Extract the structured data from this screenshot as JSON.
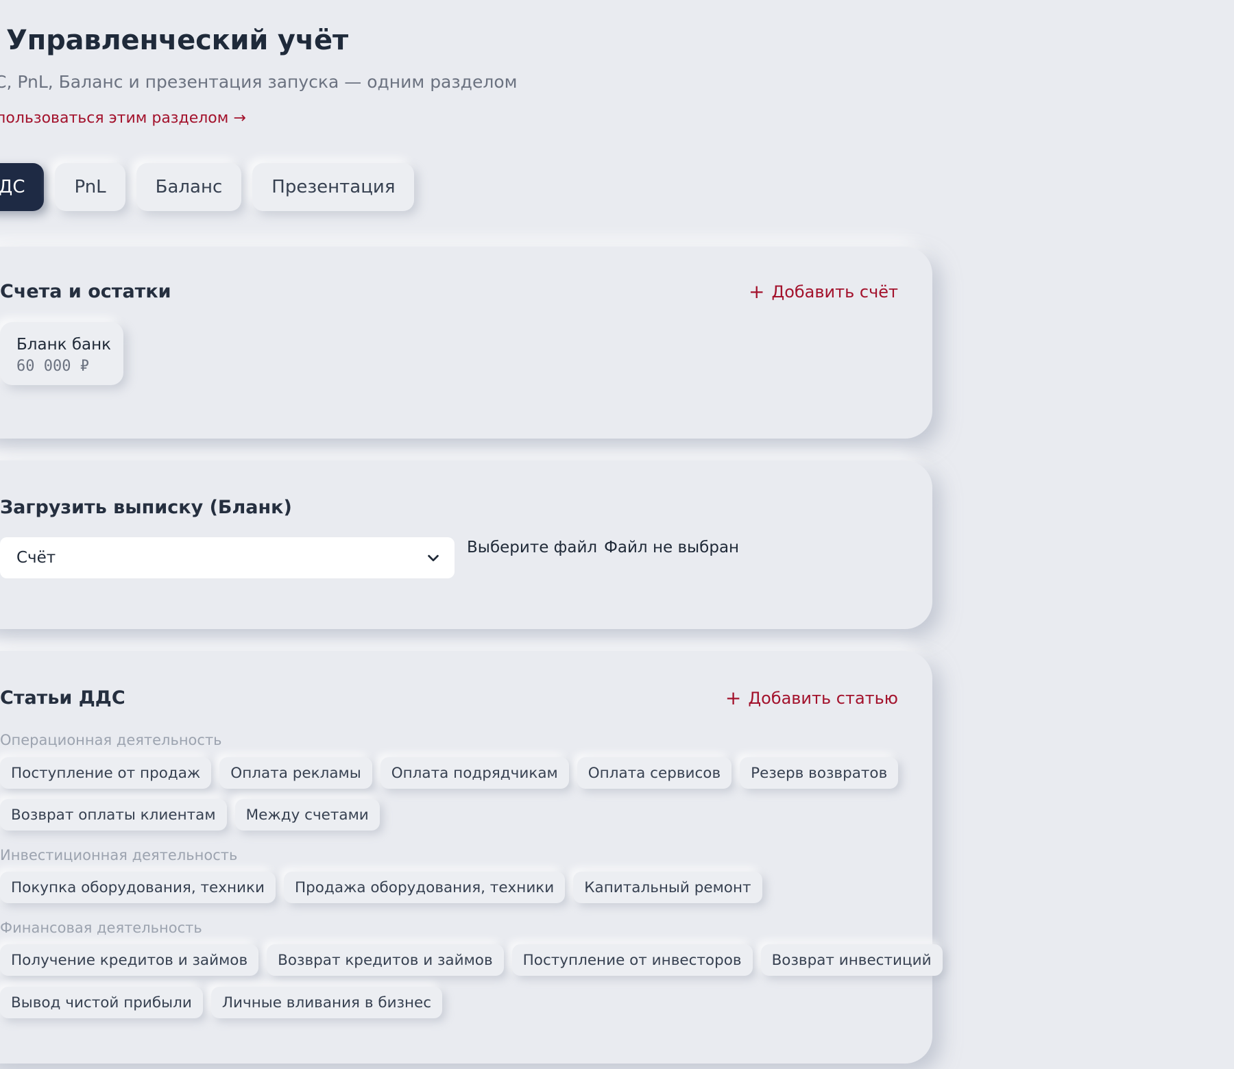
{
  "header": {
    "title": "Управленческий учёт",
    "subtitle": "С, PnL, Баланс и презентация запуска — одним разделом",
    "help_link": "пользоваться этим разделом →"
  },
  "tabs": [
    {
      "label": "ДС",
      "active": true
    },
    {
      "label": "PnL",
      "active": false
    },
    {
      "label": "Баланс",
      "active": false
    },
    {
      "label": "Презентация",
      "active": false
    }
  ],
  "accounts": {
    "title": "Счета и остатки",
    "add_label": "Добавить счёт",
    "items": [
      {
        "name": "Бланк банк",
        "balance": "60 000 ₽"
      }
    ]
  },
  "upload": {
    "title": "Загрузить выписку (Бланк)",
    "select_value": "Счёт",
    "file_button": "Выберите файл",
    "file_status": "Файл не выбран"
  },
  "categories": {
    "title": "Статьи ДДС",
    "add_label": "Добавить статью",
    "groups": [
      {
        "label": "Операционная деятельность",
        "items": [
          "Поступление от продаж",
          "Оплата рекламы",
          "Оплата подрядчикам",
          "Оплата сервисов",
          "Резерв возвратов",
          "Возврат оплаты клиентам",
          "Между счетами"
        ]
      },
      {
        "label": "Инвестиционная деятельность",
        "items": [
          "Покупка оборудования, техники",
          "Продажа оборудования, техники",
          "Капитальный ремонт"
        ]
      },
      {
        "label": "Финансовая деятельность",
        "items": [
          "Получение кредитов и займов",
          "Возврат кредитов и займов",
          "Поступление от инвесторов",
          "Возврат инвестиций",
          "Вывод чистой прибыли",
          "Личные вливания в бизнес"
        ]
      }
    ]
  },
  "colors": {
    "background": "#e9ebf0",
    "accent": "#a3122c",
    "active_tab": "#1e2a44"
  },
  "icons": [
    "plus-icon",
    "chevron-down-icon"
  ]
}
